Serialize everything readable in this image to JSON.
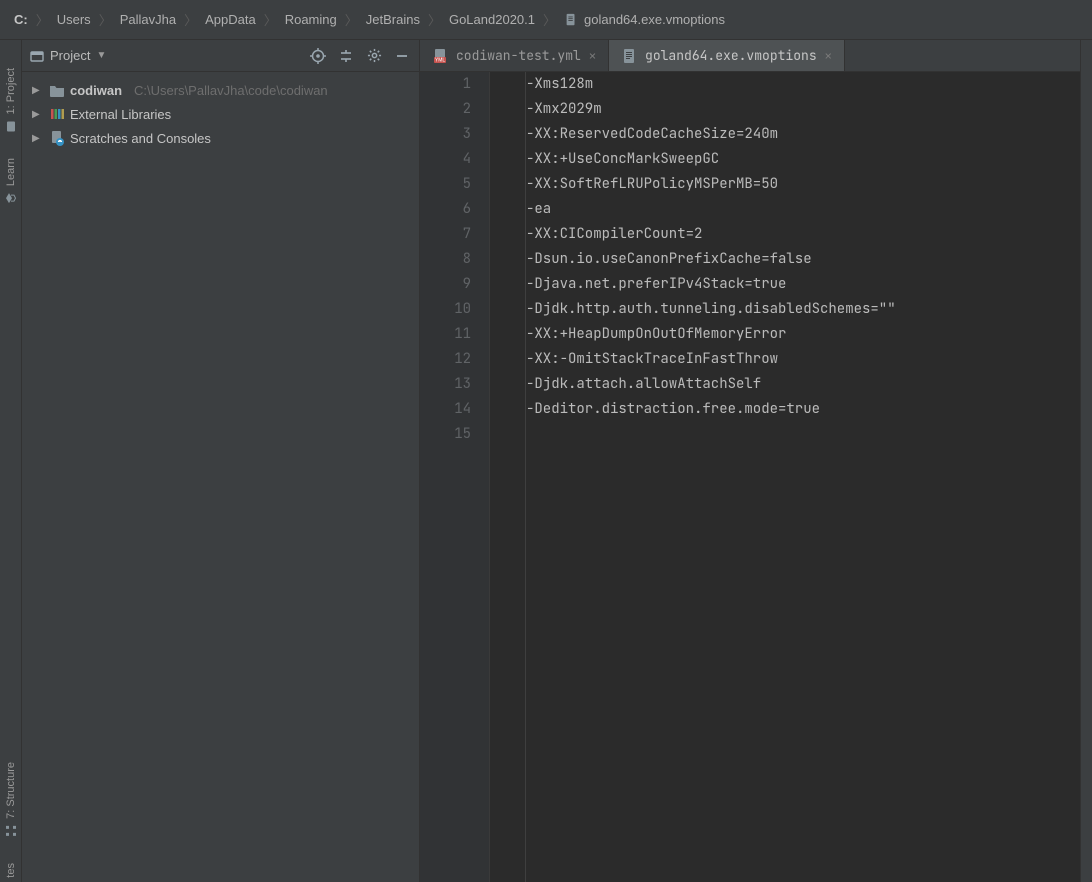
{
  "breadcrumb": {
    "items": [
      "C:",
      "Users",
      "PallavJha",
      "AppData",
      "Roaming",
      "JetBrains",
      "GoLand2020.1",
      "goland64.exe.vmoptions"
    ]
  },
  "left_tabs": {
    "project": "1: Project",
    "learn": "Learn",
    "structure": "7: Structure",
    "favorites": "tes"
  },
  "project_panel": {
    "title": "Project",
    "root": {
      "name": "codiwan",
      "path": "C:\\Users\\PallavJha\\code\\codiwan"
    },
    "ext_lib": "External Libraries",
    "scratches": "Scratches and Consoles"
  },
  "tabs": [
    {
      "label": "codiwan-test.yml",
      "type": "yml",
      "active": false
    },
    {
      "label": "goland64.exe.vmoptions",
      "type": "text",
      "active": true
    }
  ],
  "editor": {
    "current_line": 14,
    "lines": [
      "-Xms128m",
      "-Xmx2029m",
      "-XX:ReservedCodeCacheSize=240m",
      "-XX:+UseConcMarkSweepGC",
      "-XX:SoftRefLRUPolicyMSPerMB=50",
      "-ea",
      "-XX:CICompilerCount=2",
      "-Dsun.io.useCanonPrefixCache=false",
      "-Djava.net.preferIPv4Stack=true",
      "-Djdk.http.auth.tunneling.disabledSchemes=\"\"",
      "-XX:+HeapDumpOnOutOfMemoryError",
      "-XX:-OmitStackTraceInFastThrow",
      "-Djdk.attach.allowAttachSelf",
      "-Deditor.distraction.free.mode=true",
      ""
    ]
  }
}
